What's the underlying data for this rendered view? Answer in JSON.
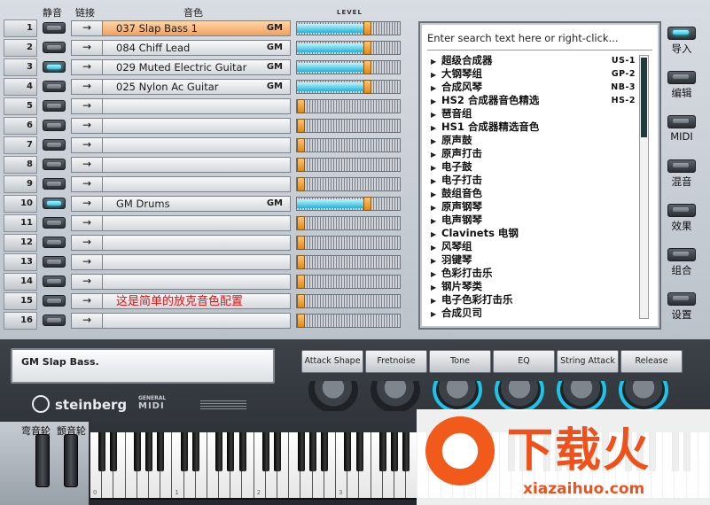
{
  "headers": {
    "mute": "静音",
    "link": "链接",
    "patch": "音色",
    "level": "LEVEL"
  },
  "channels": [
    {
      "n": "1",
      "patch": "037 Slap Bass 1",
      "tag": "GM",
      "mute_on": false,
      "level": 0.68,
      "selected": true
    },
    {
      "n": "2",
      "patch": "084 Chiff Lead",
      "tag": "GM",
      "mute_on": false,
      "level": 0.68,
      "selected": false
    },
    {
      "n": "3",
      "patch": "029 Muted Electric Guitar",
      "tag": "GM",
      "mute_on": true,
      "level": 0.68,
      "selected": false
    },
    {
      "n": "4",
      "patch": "025 Nylon Ac Guitar",
      "tag": "GM",
      "mute_on": false,
      "level": 0.68,
      "selected": false
    },
    {
      "n": "5",
      "patch": "",
      "tag": "",
      "mute_on": false,
      "level": 0,
      "selected": false
    },
    {
      "n": "6",
      "patch": "",
      "tag": "",
      "mute_on": false,
      "level": 0,
      "selected": false
    },
    {
      "n": "7",
      "patch": "",
      "tag": "",
      "mute_on": false,
      "level": 0,
      "selected": false
    },
    {
      "n": "8",
      "patch": "",
      "tag": "",
      "mute_on": false,
      "level": 0,
      "selected": false
    },
    {
      "n": "9",
      "patch": "",
      "tag": "",
      "mute_on": false,
      "level": 0,
      "selected": false
    },
    {
      "n": "10",
      "patch": "GM Drums",
      "tag": "GM",
      "mute_on": true,
      "level": 0.68,
      "selected": false
    },
    {
      "n": "11",
      "patch": "",
      "tag": "",
      "mute_on": false,
      "level": 0,
      "selected": false
    },
    {
      "n": "12",
      "patch": "",
      "tag": "",
      "mute_on": false,
      "level": 0,
      "selected": false
    },
    {
      "n": "13",
      "patch": "",
      "tag": "",
      "mute_on": false,
      "level": 0,
      "selected": false
    },
    {
      "n": "14",
      "patch": "",
      "tag": "",
      "mute_on": false,
      "level": 0,
      "selected": false
    },
    {
      "n": "15",
      "patch": "",
      "tag": "",
      "mute_on": false,
      "level": 0,
      "selected": false,
      "note": "这是简单的放克音色配置"
    },
    {
      "n": "16",
      "patch": "",
      "tag": "",
      "mute_on": false,
      "level": 0,
      "selected": false
    }
  ],
  "link_glyph": "→",
  "browser": {
    "search_placeholder": "Enter search text here or right-click...",
    "categories": [
      {
        "label": "超级合成器",
        "tag": "US-1"
      },
      {
        "label": "大钢琴组",
        "tag": "GP-2"
      },
      {
        "label": "合成风琴",
        "tag": "NB-3"
      },
      {
        "label": "HS2 合成器音色精选",
        "tag": "HS-2"
      },
      {
        "label": "琶音组",
        "tag": ""
      },
      {
        "label": "HS1 合成器精选音色",
        "tag": ""
      },
      {
        "label": "原声鼓",
        "tag": ""
      },
      {
        "label": "原声打击",
        "tag": ""
      },
      {
        "label": "电子鼓",
        "tag": ""
      },
      {
        "label": "电子打击",
        "tag": ""
      },
      {
        "label": "鼓组音色",
        "tag": ""
      },
      {
        "label": "原声钢琴",
        "tag": ""
      },
      {
        "label": "电声钢琴",
        "tag": ""
      },
      {
        "label": "Clavinets 电钢",
        "tag": ""
      },
      {
        "label": "风琴组",
        "tag": ""
      },
      {
        "label": "羽键琴",
        "tag": ""
      },
      {
        "label": "色彩打击乐",
        "tag": ""
      },
      {
        "label": "钢片琴类",
        "tag": ""
      },
      {
        "label": "电子色彩打击乐",
        "tag": ""
      },
      {
        "label": "合成贝司",
        "tag": ""
      }
    ]
  },
  "side_buttons": [
    {
      "label": "导入",
      "on": true
    },
    {
      "label": "编辑",
      "on": false
    },
    {
      "label": "MIDI",
      "on": false
    },
    {
      "label": "混音",
      "on": false
    },
    {
      "label": "效果",
      "on": false
    },
    {
      "label": "组合",
      "on": false
    },
    {
      "label": "设置",
      "on": false
    }
  ],
  "lcd_text": "GM Slap Bass.",
  "controls": [
    "Attack Shape",
    "Fretnoise",
    "Tone",
    "EQ",
    "String Attack",
    "Release"
  ],
  "brand": {
    "steinberg": "steinberg",
    "gm": "MIDI",
    "gm_top": "GENERAL"
  },
  "wheels": {
    "pitch": "弯音轮",
    "mod": "颤音轮"
  },
  "octave_labels": [
    "0",
    "1",
    "2",
    "3"
  ],
  "watermark": {
    "big": "下载火",
    "url": "xiazaihuo.com"
  },
  "colors": {
    "accent_cyan": "#27c6e6",
    "selected_row": "#f0a060",
    "slider_knob": "#e08a18"
  }
}
